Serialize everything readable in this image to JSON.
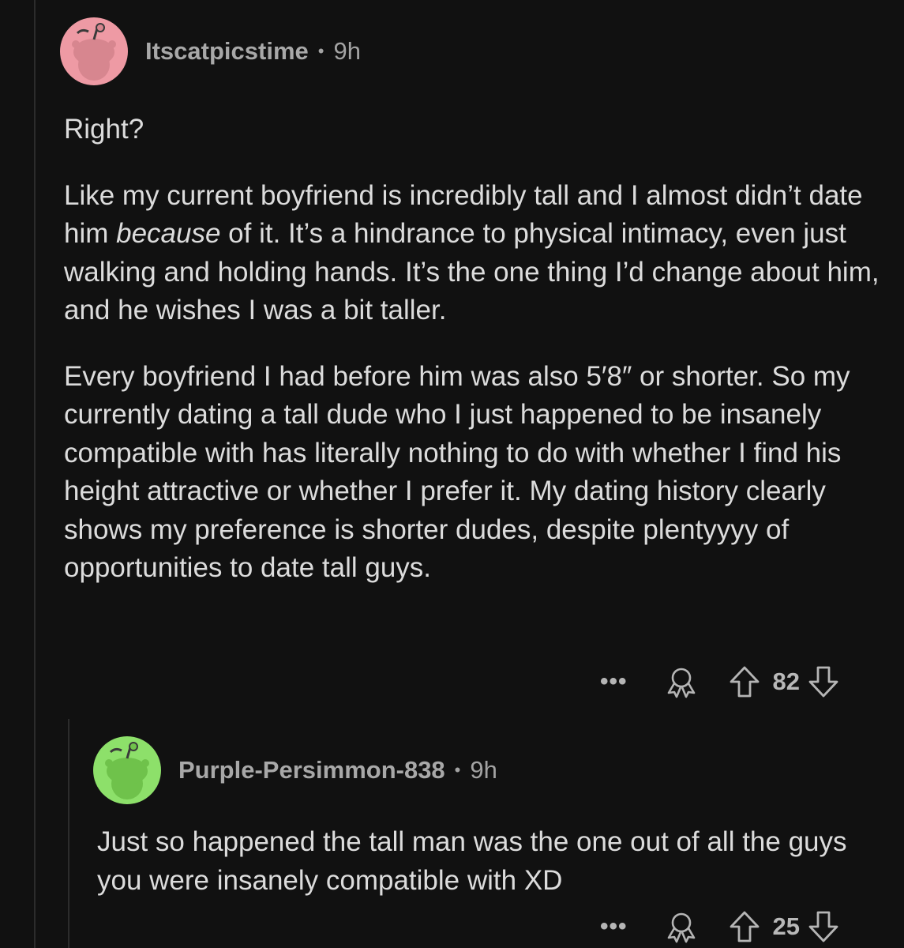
{
  "comments": [
    {
      "username": "Itscatpicstime",
      "separator": "•",
      "age": "9h",
      "avatar_color": "#ee9aa4",
      "paragraphs": [
        "Right?",
        {
          "before": "Like my current boyfriend is incredibly tall and I almost didn’t date him ",
          "em": "because",
          "after": " of it. It’s a hindrance to physical intimacy, even just walking and holding hands. It’s the one thing I’d change about him, and he wishes I was a bit taller."
        },
        "Every boyfriend I had before him was also 5′8″ or shorter. So my currently dating a tall dude who I just happened to be insanely compatible with has literally nothing to do with whether I find his height attractive or whether I prefer it. My dating history clearly shows my preference is shorter dudes, despite plentyyyy of opportunities to date tall guys."
      ],
      "more_label": "•••",
      "award_icon": "award-icon",
      "upvote_icon": "upvote-icon",
      "score": "82",
      "downvote_icon": "downvote-icon"
    },
    {
      "username": "Purple-Persimmon-838",
      "separator": "•",
      "age": "9h",
      "avatar_color": "#8de06a",
      "paragraphs": [
        "Just so happened the tall man was the one out of all the guys you were insanely compatible with XD"
      ],
      "more_label": "•••",
      "award_icon": "award-icon",
      "upvote_icon": "upvote-icon",
      "score": "25",
      "downvote_icon": "downvote-icon"
    }
  ]
}
